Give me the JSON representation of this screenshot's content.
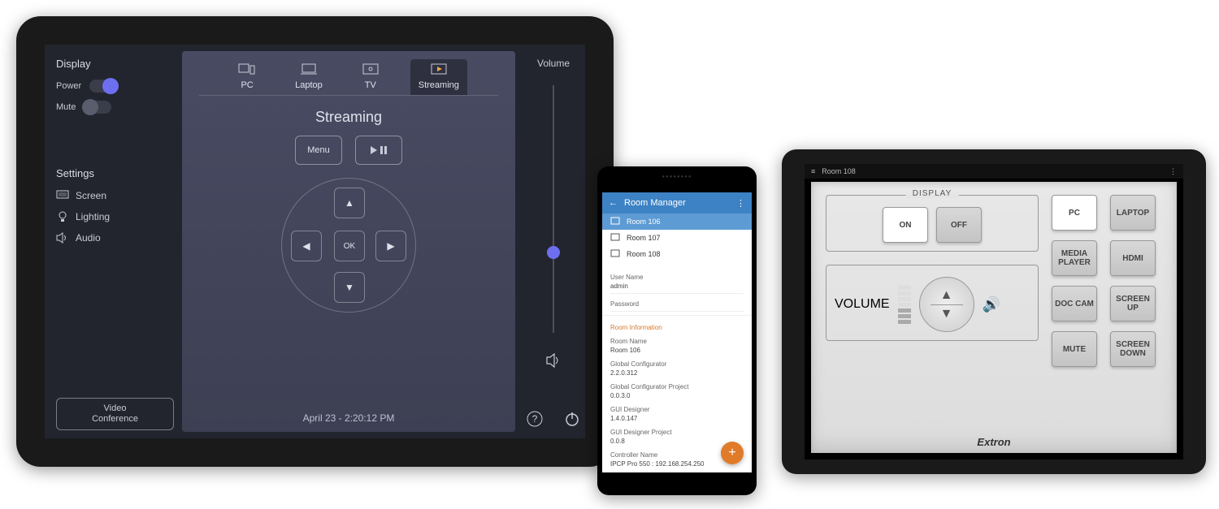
{
  "tablet1": {
    "sidebar": {
      "display_label": "Display",
      "power_label": "Power",
      "mute_label": "Mute",
      "settings_label": "Settings",
      "screen_label": "Screen",
      "lighting_label": "Lighting",
      "audio_label": "Audio",
      "video_conference_label": "Video\nConference"
    },
    "main": {
      "tabs": {
        "pc": "PC",
        "laptop": "Laptop",
        "tv": "TV",
        "streaming": "Streaming"
      },
      "title": "Streaming",
      "menu_btn": "Menu",
      "ok_btn": "OK",
      "datetime": "April 23 - 2:20:12 PM"
    },
    "right": {
      "volume_label": "Volume"
    }
  },
  "phone": {
    "appbar_title": "Room Manager",
    "rooms": {
      "r1": "Room 106",
      "r2": "Room 107",
      "r3": "Room 108"
    },
    "fields": {
      "user_name_label": "User Name",
      "user_name_value": "admin",
      "password_label": "Password",
      "room_info_header": "Room Information",
      "room_name_label": "Room Name",
      "room_name_value": "Room 106",
      "gc_label": "Global Configurator",
      "gc_value": "2.2.0.312",
      "gcp_label": "Global Configurator Project",
      "gcp_value": "0.0.3.0",
      "gd_label": "GUI Designer",
      "gd_value": "1.4.0.147",
      "gdp_label": "GUI Designer Project",
      "gdp_value": "0.0.8",
      "ctrl_label": "Controller Name",
      "ctrl_value": "IPCP Pro 550 : 192.168.254.250"
    }
  },
  "tablet2": {
    "title": "Room 108",
    "display_label": "DISPLAY",
    "volume_label": "VOLUME",
    "on_label": "ON",
    "off_label": "OFF",
    "sources": {
      "pc": "PC",
      "laptop": "LAPTOP",
      "media_player": "MEDIA PLAYER",
      "hdmi": "HDMI",
      "doc_cam": "DOC CAM",
      "screen_up": "SCREEN UP",
      "mute": "MUTE",
      "screen_down": "SCREEN DOWN"
    },
    "brand": "Extron"
  }
}
